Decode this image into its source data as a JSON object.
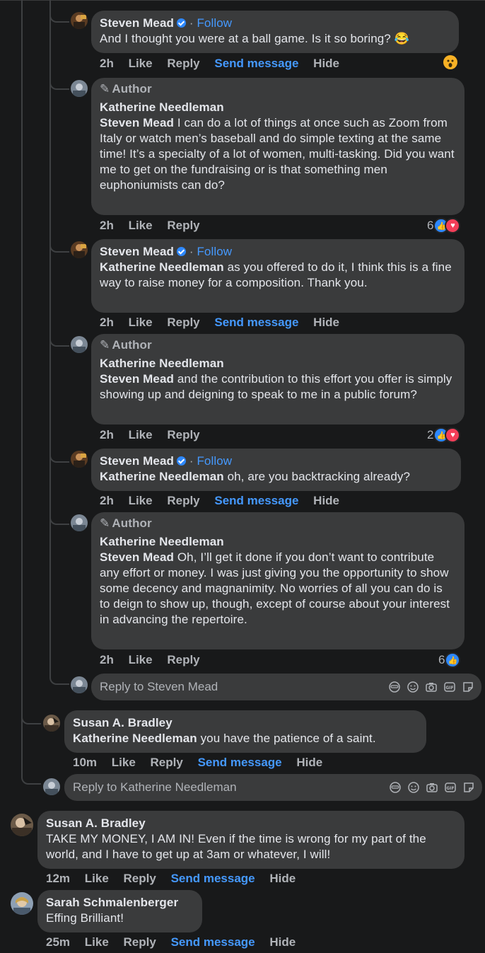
{
  "common": {
    "like": "Like",
    "reply": "Reply",
    "send_message": "Send message",
    "hide": "Hide",
    "follow": "Follow",
    "dot": "·",
    "author_badge": "Author"
  },
  "comments": [
    {
      "author": "Steven Mead",
      "text": "And I thought you were at a ball game. Is it so boring? 😂",
      "time": "2h"
    },
    {
      "author": "Katherine Needleman",
      "mention": "Steven Mead",
      "text": "I can do a lot of things at once such as Zoom from Italy or watch men’s baseball and do simple texting at the same time! It’s a specialty of a lot of women, multi-tasking. Did you want me to get on the fundraising or is that something men euphoniumists can do?",
      "time": "2h",
      "reaction_count": "6"
    },
    {
      "author": "Steven Mead",
      "mention": "Katherine Needleman",
      "text": "as you offered to do it, I think this is a fine way to raise money for a composition. Thank you.",
      "time": "2h"
    },
    {
      "author": "Katherine Needleman",
      "mention": "Steven Mead",
      "text": "and the contribution to this effort you offer is simply showing up and deigning to speak to me in a public forum?",
      "time": "2h",
      "reaction_count": "2"
    },
    {
      "author": "Steven Mead",
      "mention": "Katherine Needleman",
      "text": "oh, are you backtracking already?",
      "time": "2h"
    },
    {
      "author": "Katherine Needleman",
      "mention": "Steven Mead",
      "text": "Oh, I’ll get it done if you don’t want to contribute any effort or money. I was just giving you the opportunity to show some decency and magnanimity. No worries of all you can do is to deign to show up, though, except of course about your interest in advancing the repertoire.",
      "time": "2h",
      "reaction_count": "6"
    },
    {
      "author": "Susan A. Bradley",
      "mention": "Katherine Needleman",
      "text": "you have the patience of a saint.",
      "time": "10m"
    },
    {
      "author": "Susan A. Bradley",
      "text": "TAKE MY MONEY, I AM IN! Even if the time is wrong for my part of the world, and I have to get up at 3am or whatever, I will!",
      "time": "12m"
    },
    {
      "author": "Sarah Schmalenberger",
      "text": "Effing Brilliant!",
      "time": "25m"
    }
  ],
  "reply_boxes": [
    {
      "placeholder": "Reply to Steven Mead"
    },
    {
      "placeholder": "Reply to Katherine Needleman"
    }
  ],
  "icons": {
    "verified": "verified-badge-icon",
    "wow_reaction": "wow-reaction-icon",
    "like_reaction": "like-reaction-icon",
    "love_reaction": "love-reaction-icon",
    "pencil": "pencil-icon"
  },
  "colors": {
    "background": "#18191a",
    "bubble": "#3a3b3c",
    "link_blue": "#4599ff",
    "muted": "#b0b3b8"
  }
}
